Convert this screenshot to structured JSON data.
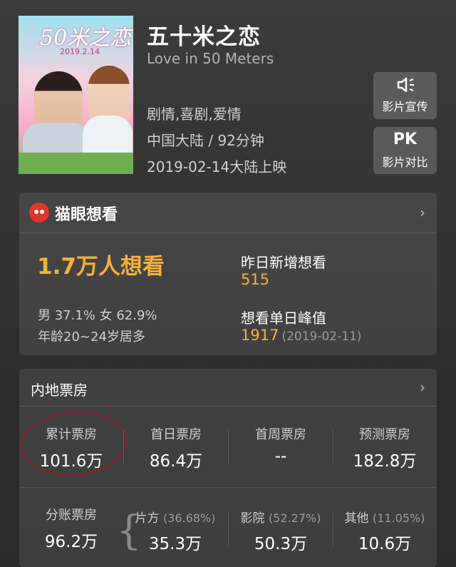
{
  "movie": {
    "title": "五十米之恋",
    "subtitle": "Love in 50 Meters",
    "genres": "剧情,喜剧,爱情",
    "region_duration": "中国大陆 / 92分钟",
    "release": "2019-02-14大陆上映",
    "poster": {
      "title": "50米之恋",
      "date": "2019.2.14"
    }
  },
  "side_buttons": {
    "promo": {
      "icon": "speaker-icon",
      "label": "影片宣传"
    },
    "pk": {
      "icon_text": "PK",
      "label": "影片对比"
    }
  },
  "maoyan": {
    "brand": "猫眼想看",
    "want_count": "1.7万人想看",
    "gender": "男 37.1% 女 62.9%",
    "age": "年龄20~24岁居多",
    "new_yesterday_label": "昨日新增想看",
    "new_yesterday_value": "515",
    "peak_label": "想看单日峰值",
    "peak_value": "1917",
    "peak_date": "(2019-02-11)"
  },
  "boxoffice": {
    "title": "内地票房",
    "row1": [
      {
        "label": "累计票房",
        "value": "101.6万"
      },
      {
        "label": "首日票房",
        "value": "86.4万"
      },
      {
        "label": "首周票房",
        "value": "--"
      },
      {
        "label": "预测票房",
        "value": "182.8万"
      }
    ],
    "split": {
      "label": "分账票房",
      "value": "96.2万"
    },
    "parts": [
      {
        "label": "片方",
        "pct": "(36.68%)",
        "value": "35.3万"
      },
      {
        "label": "影院",
        "pct": "(52.27%)",
        "value": "50.3万"
      },
      {
        "label": "其他",
        "pct": "(11.05%)",
        "value": "10.6万"
      }
    ]
  },
  "colors": {
    "accent": "#f6b13a",
    "brand_red": "#e0352b",
    "annotation_circle": "#8e1f24"
  }
}
